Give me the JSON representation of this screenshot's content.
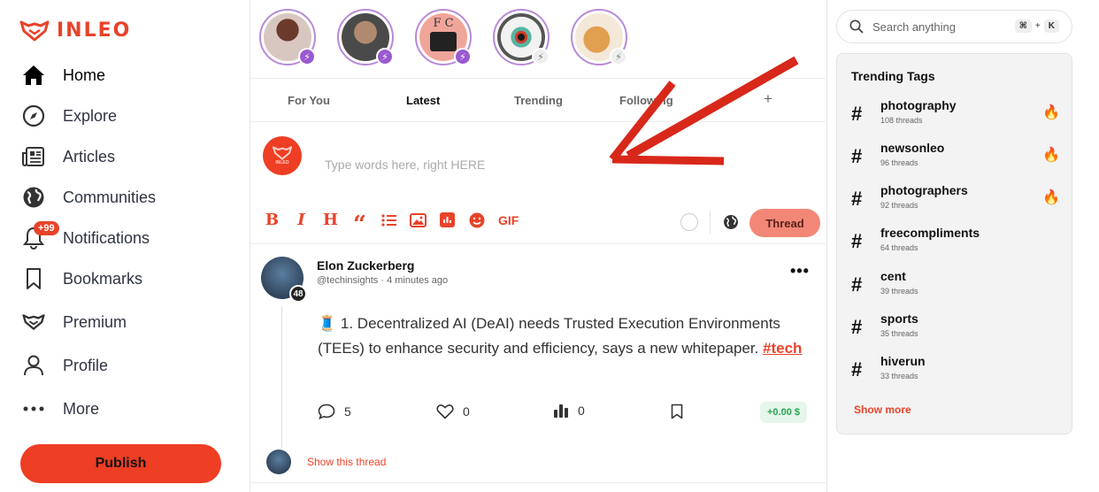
{
  "brand": {
    "logo_text": "INLEO",
    "accent": "#e8432a"
  },
  "nav": {
    "items": [
      {
        "label": "Home",
        "icon": "home-icon",
        "active": true
      },
      {
        "label": "Explore",
        "icon": "compass-icon"
      },
      {
        "label": "Articles",
        "icon": "newspaper-icon"
      },
      {
        "label": "Communities",
        "icon": "globe-icon"
      },
      {
        "label": "Notifications",
        "icon": "bell-icon",
        "badge": "+99"
      },
      {
        "label": "Bookmarks",
        "icon": "bookmark-icon"
      },
      {
        "label": "Premium",
        "icon": "leo-icon"
      },
      {
        "label": "Profile",
        "icon": "user-icon"
      },
      {
        "label": "More",
        "icon": "dots-icon"
      }
    ],
    "publish_label": "Publish"
  },
  "stories": [
    {
      "name": "story-1",
      "bolt": "purple"
    },
    {
      "name": "story-2",
      "bolt": "purple"
    },
    {
      "name": "story-3",
      "bolt": "purple",
      "text": "F C"
    },
    {
      "name": "story-4",
      "bolt": "gray"
    },
    {
      "name": "story-5",
      "bolt": "gray"
    }
  ],
  "feed_tabs": {
    "for_you": "For You",
    "latest": "Latest",
    "trending": "Trending",
    "following": "Following",
    "add": "+"
  },
  "composer": {
    "placeholder": "Type words here, right HERE",
    "gif_label": "GIF",
    "thread_button": "Thread"
  },
  "post": {
    "author": "Elon Zuckerberg",
    "handle": "@techinsights",
    "time": "4 minutes ago",
    "level": "48",
    "emoji": "🧵",
    "text": " 1. Decentralized AI (DeAI) needs Trusted Execution Environments (TEEs) to enhance security and efficiency, says a new whitepaper. ",
    "tag": "#tech",
    "comments": "5",
    "likes": "0",
    "views": "0",
    "reward": "+0.00 $",
    "show_thread": "Show this thread"
  },
  "search": {
    "placeholder": "Search anything",
    "shortcut_mod": "⌘",
    "shortcut_plus": "+",
    "shortcut_key": "K"
  },
  "trending": {
    "title": "Trending Tags",
    "tags": [
      {
        "name": "photography",
        "count": "108 threads",
        "hot": true
      },
      {
        "name": "newsonleo",
        "count": "96 threads",
        "hot": true
      },
      {
        "name": "photographers",
        "count": "92 threads",
        "hot": true
      },
      {
        "name": "freecompliments",
        "count": "64 threads",
        "hot": false
      },
      {
        "name": "cent",
        "count": "39 threads",
        "hot": false
      },
      {
        "name": "sports",
        "count": "35 threads",
        "hot": false
      },
      {
        "name": "hiverun",
        "count": "33 threads",
        "hot": false
      }
    ],
    "show_more": "Show more",
    "hash": "#",
    "fire": "🔥"
  }
}
